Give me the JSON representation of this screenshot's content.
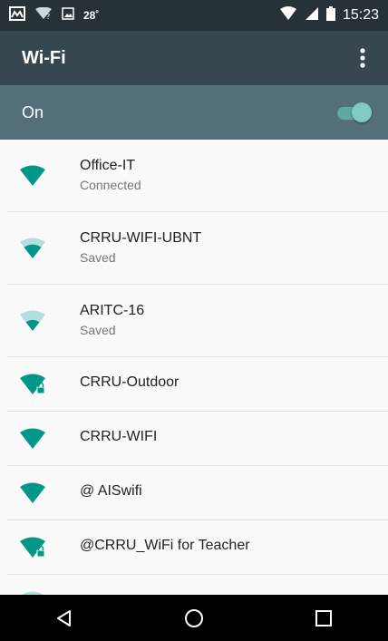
{
  "status_bar": {
    "temperature": "28˚",
    "time": "15:23"
  },
  "toolbar": {
    "title": "Wi-Fi"
  },
  "wifi_toggle": {
    "label": "On",
    "enabled": true
  },
  "networks": [
    {
      "ssid": "Office-IT",
      "status": "Connected",
      "secured": false,
      "icon": "wifi-full-icon"
    },
    {
      "ssid": "CRRU-WIFI-UBNT",
      "status": "Saved",
      "secured": false,
      "icon": "wifi-medium-icon"
    },
    {
      "ssid": "ARITC-16",
      "status": "Saved",
      "secured": false,
      "icon": "wifi-medium-icon"
    },
    {
      "ssid": "CRRU-Outdoor",
      "status": "",
      "secured": true,
      "icon": "wifi-lock-icon"
    },
    {
      "ssid": "CRRU-WIFI",
      "status": "",
      "secured": false,
      "icon": "wifi-full-icon"
    },
    {
      "ssid": "@ AISwifi",
      "status": "",
      "secured": false,
      "icon": "wifi-full-icon"
    },
    {
      "ssid": "@CRRU_WiFi for Teacher",
      "status": "",
      "secured": true,
      "icon": "wifi-lock-icon"
    }
  ],
  "colors": {
    "status_bar": "#263238",
    "toolbar": "#37474f",
    "toggle_bar": "#546e7a",
    "accent": "#009688"
  }
}
